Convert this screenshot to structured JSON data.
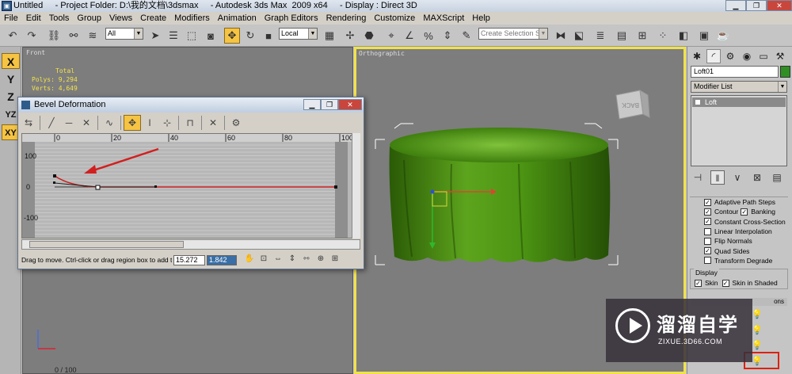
{
  "titlebar": {
    "app_icon": "3ds-max-icon",
    "title": "Untitled     - Project Folder: D:\\我的文档\\3dsmax     - Autodesk 3ds Max  2009 x64     - Display : Direct 3D"
  },
  "window_controls": {
    "minimize": "▁",
    "maximize": "❐",
    "close": "✕"
  },
  "menu": [
    "File",
    "Edit",
    "Tools",
    "Group",
    "Views",
    "Create",
    "Modifiers",
    "Animation",
    "Graph Editors",
    "Rendering",
    "Customize",
    "MAXScript",
    "Help"
  ],
  "toolbar": {
    "icons": [
      "undo",
      "redo",
      "select-link",
      "unlink",
      "bind-space-warp"
    ],
    "selection_filter": "All",
    "icons2": [
      "select-object",
      "select-by-name",
      "rect-selection",
      "window-crossing",
      "select-and-move",
      "select-and-rotate",
      "select-and-scale"
    ],
    "ref_coord": "Local",
    "icons3": [
      "use-pivot",
      "select-manipulate",
      "snap-2.5",
      "angle-snap",
      "percent-snap",
      "spinner-snap"
    ],
    "named_selection_placeholder": "Create Selection Se",
    "icons4": [
      "mirror",
      "align",
      "layer-manager",
      "curve-editor",
      "schematic-view",
      "material-editor",
      "render-setup",
      "quick-render"
    ]
  },
  "left_tools": [
    "X",
    "Y",
    "Z",
    "YZ",
    "XY"
  ],
  "viewport_front": {
    "label": "Front",
    "stats": {
      "total": "Total",
      "polys": "Polys: 9,294",
      "verts": "Verts: 4,649"
    }
  },
  "frame_counter": "0 / 100",
  "viewport_ortho": {
    "label": "Orthographic",
    "viewcube_face": "BACK"
  },
  "command_panel": {
    "tabs": [
      "create",
      "modify",
      "hierarchy",
      "motion",
      "display",
      "utilities"
    ],
    "object_name": "Loft01",
    "object_color": "#2f8f22",
    "modifier_list": "Modifier List",
    "stack_item": "Loft",
    "skin_params": [
      {
        "label": "Adaptive Path Steps",
        "checked": true
      },
      {
        "label": "Contour",
        "checked": true,
        "label2": "Banking",
        "checked2": true
      },
      {
        "label": "Constant Cross-Section",
        "checked": true
      },
      {
        "label": "Linear Interpolation",
        "checked": false
      },
      {
        "label": "Flip Normals",
        "checked": false
      },
      {
        "label": "Quad Sides",
        "checked": true
      },
      {
        "label": "Transform Degrade",
        "checked": false
      }
    ],
    "display_group": "Display",
    "display_skin": "Skin",
    "display_skin_shaded": "Skin in Shaded",
    "deformations_header": "ons"
  },
  "bevel_dialog": {
    "title": "Bevel Deformation",
    "x_ticks": [
      "0",
      "20",
      "40",
      "60",
      "80",
      "100"
    ],
    "y_ticks": [
      "100",
      "0",
      "-100"
    ],
    "status_message": "Drag to move. Ctrl-click or drag region box to add to s",
    "field_x": "15.272",
    "field_y": "1.842"
  },
  "watermark": {
    "text": "溜溜自学",
    "url": "ZIXUE.3D66.COM"
  },
  "colors": {
    "highlight": "#f6c443",
    "curve_red": "#cc1f1f",
    "object_green": "#3d8b12",
    "annotation_red": "#d21f1f"
  }
}
